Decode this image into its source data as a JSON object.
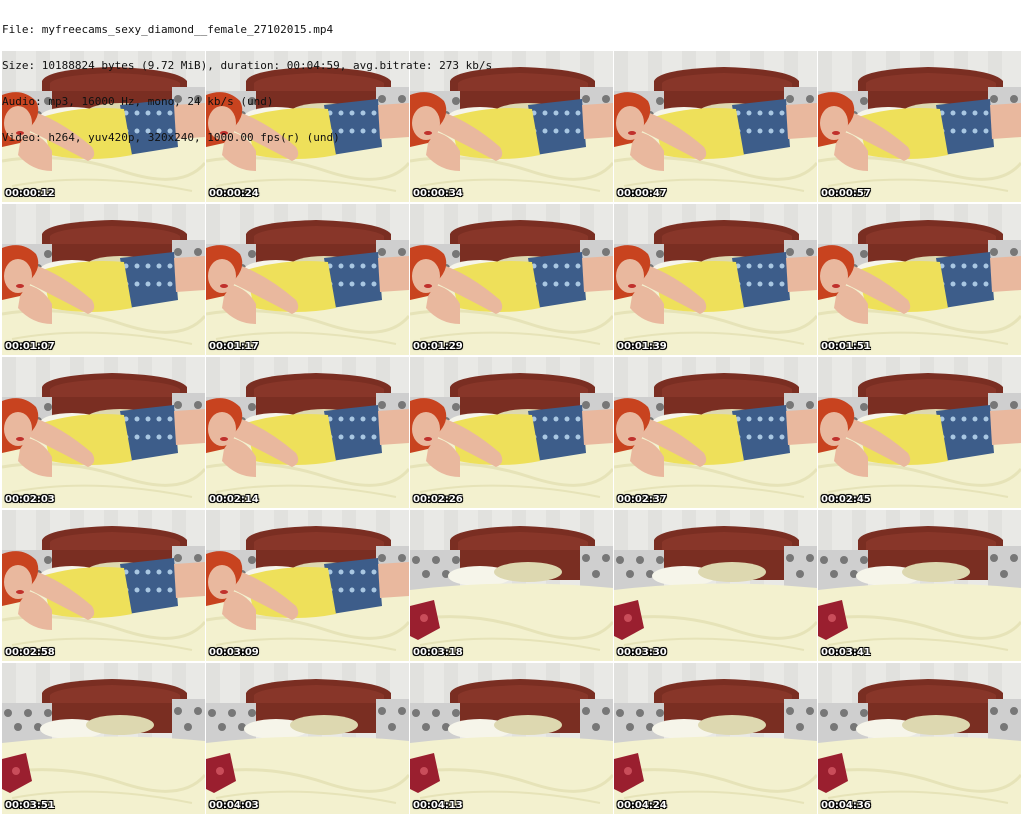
{
  "header": {
    "lines": [
      "File: myfreecams_sexy_diamond__female_27102015.mp4",
      "Size: 10188824 bytes (9.72 MiB), duration: 00:04:59, avg.bitrate: 273 kb/s",
      "Audio: mp3, 16000 Hz, mono, 24 kb/s (und)",
      "Video: h264, yuv420p, 320x240, 1000.00 fps(r) (und)"
    ]
  },
  "frames": [
    {
      "timestamp": "00:00:12",
      "scene": "person"
    },
    {
      "timestamp": "00:00:24",
      "scene": "person"
    },
    {
      "timestamp": "00:00:34",
      "scene": "person"
    },
    {
      "timestamp": "00:00:47",
      "scene": "person"
    },
    {
      "timestamp": "00:00:57",
      "scene": "person"
    },
    {
      "timestamp": "00:01:07",
      "scene": "person"
    },
    {
      "timestamp": "00:01:17",
      "scene": "person"
    },
    {
      "timestamp": "00:01:29",
      "scene": "person"
    },
    {
      "timestamp": "00:01:39",
      "scene": "person"
    },
    {
      "timestamp": "00:01:51",
      "scene": "person"
    },
    {
      "timestamp": "00:02:03",
      "scene": "person"
    },
    {
      "timestamp": "00:02:14",
      "scene": "person"
    },
    {
      "timestamp": "00:02:26",
      "scene": "person"
    },
    {
      "timestamp": "00:02:37",
      "scene": "person"
    },
    {
      "timestamp": "00:02:45",
      "scene": "person"
    },
    {
      "timestamp": "00:02:58",
      "scene": "person"
    },
    {
      "timestamp": "00:03:09",
      "scene": "person"
    },
    {
      "timestamp": "00:03:18",
      "scene": "bed"
    },
    {
      "timestamp": "00:03:30",
      "scene": "bed"
    },
    {
      "timestamp": "00:03:41",
      "scene": "bed"
    },
    {
      "timestamp": "00:03:51",
      "scene": "bed"
    },
    {
      "timestamp": "00:04:03",
      "scene": "bed"
    },
    {
      "timestamp": "00:04:13",
      "scene": "bed"
    },
    {
      "timestamp": "00:04:24",
      "scene": "bed"
    },
    {
      "timestamp": "00:04:36",
      "scene": "bed"
    }
  ],
  "colors": {
    "wall": "#e9e9e6",
    "headboard": "#7a2e22",
    "sheet": "#f3f1cf",
    "pillow": "#ddd8b0",
    "hair": "#c8431f",
    "skin": "#e9b89e",
    "top": "#eee05a",
    "skirt": "#3d5d8a",
    "cushion": "#9a1f2f",
    "timestamp": "#ffffff"
  }
}
